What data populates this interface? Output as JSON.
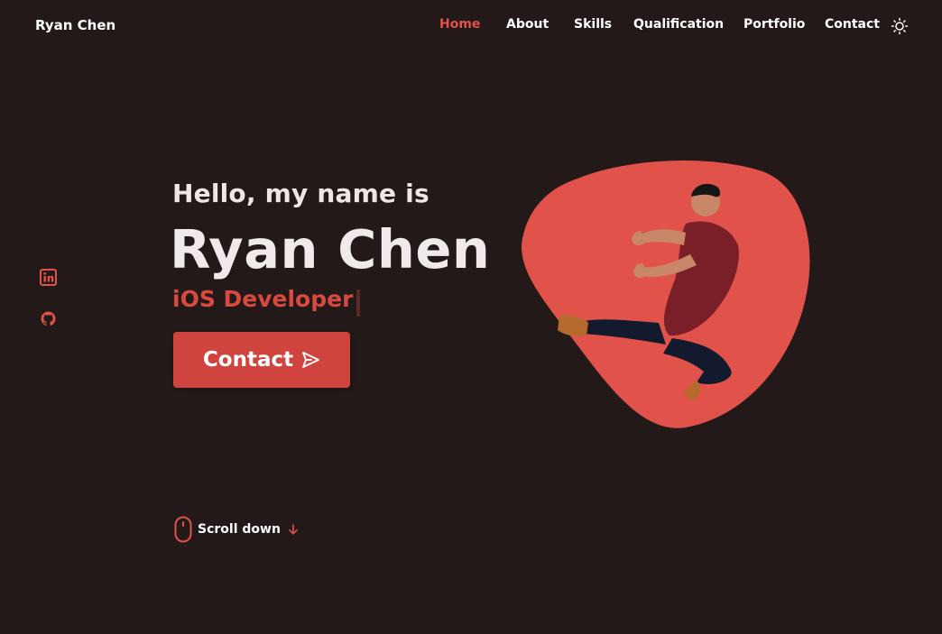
{
  "header": {
    "logo": "Ryan Chen",
    "nav": [
      {
        "label": "Home",
        "active": true
      },
      {
        "label": "About"
      },
      {
        "label": "Skills"
      },
      {
        "label": "Qualification"
      },
      {
        "label": "Portfolio"
      },
      {
        "label": "Contact"
      }
    ],
    "theme_icon": "sun-icon"
  },
  "social": [
    {
      "icon": "linkedin-icon"
    },
    {
      "icon": "github-icon"
    }
  ],
  "hero": {
    "greeting": "Hello, my name is",
    "name": "Ryan Chen",
    "role": "iOS Developer",
    "contact_label": "Contact",
    "scroll_label": "Scroll down"
  },
  "colors": {
    "background": "#231918",
    "accent": "#e1534a",
    "button": "#cf443e",
    "blob": "#e1534a"
  }
}
